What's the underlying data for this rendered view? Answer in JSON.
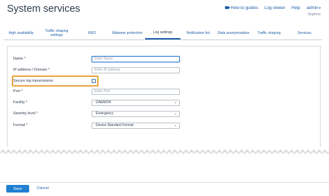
{
  "page": {
    "title": "System services"
  },
  "top_links": {
    "guides": "How-to guides",
    "log_viewer": "Log viewer",
    "help": "Help",
    "user": "admin",
    "org": "Sophos"
  },
  "tabs": [
    {
      "label": "High availability",
      "active": false
    },
    {
      "label": "Traffic shaping settings",
      "active": false
    },
    {
      "label": "RED",
      "active": false
    },
    {
      "label": "Malware protection",
      "active": false
    },
    {
      "label": "Log settings",
      "active": true
    },
    {
      "label": "Notification list",
      "active": false
    },
    {
      "label": "Data anonymization",
      "active": false
    },
    {
      "label": "Traffic shaping",
      "active": false
    },
    {
      "label": "Services",
      "active": false
    }
  ],
  "form": {
    "name": {
      "label": "Name",
      "required": "*",
      "placeholder": "Enter Name"
    },
    "ip": {
      "label": "IP address / Domain",
      "required": "*",
      "placeholder": "Enter IP address"
    },
    "secure": {
      "label": "Secure log transmission",
      "checked": false
    },
    "port": {
      "label": "Port",
      "required": "*",
      "placeholder": "Enter Port"
    },
    "facility": {
      "label": "Facility",
      "required": "*",
      "value": "DAEMON"
    },
    "severity": {
      "label": "Severity level",
      "required": "*",
      "value": "Emergency"
    },
    "format": {
      "label": "Format",
      "required": "*",
      "value": "Device Standard Format"
    }
  },
  "footer": {
    "save_label": "Save",
    "cancel_label": "Cancel"
  },
  "colors": {
    "accent": "#1f7fd1",
    "highlight": "#e8a33a"
  }
}
